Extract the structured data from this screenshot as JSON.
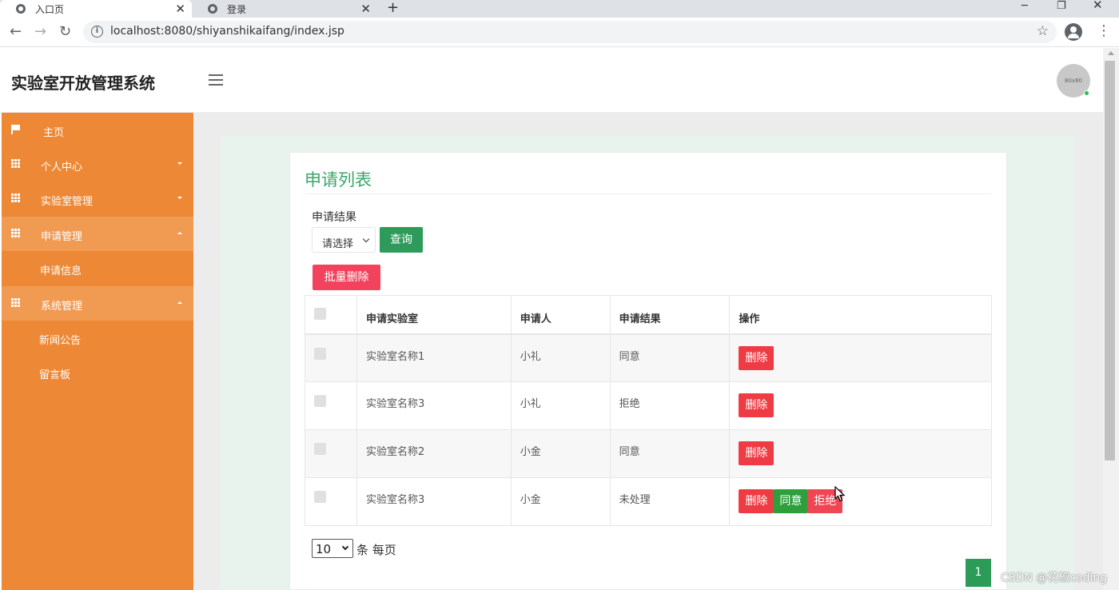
{
  "browser": {
    "tabs": [
      {
        "title": "入口页",
        "active": true
      },
      {
        "title": "登录",
        "active": false
      }
    ],
    "url": "localhost:8080/shiyanshikaifang/index.jsp"
  },
  "header": {
    "brand": "实验室开放管理系统",
    "avatar_text": "80x80"
  },
  "sidebar": {
    "items": [
      {
        "label": "主页",
        "icon": "flag-icon"
      },
      {
        "label": "个人中心",
        "icon": "grid-icon"
      },
      {
        "label": "实验室管理",
        "icon": "grid-icon"
      },
      {
        "label": "申请管理",
        "icon": "grid-icon"
      },
      {
        "label": "申请信息"
      },
      {
        "label": "系统管理",
        "icon": "grid-icon"
      },
      {
        "label": "新闻公告"
      },
      {
        "label": "留言板"
      }
    ]
  },
  "main": {
    "title": "申请列表",
    "filter": {
      "label": "申请结果",
      "select_value": "请选择",
      "query_button": "查询"
    },
    "batch_delete": "批量删除",
    "table": {
      "headers": [
        "申请实验室",
        "申请人",
        "申请结果",
        "操作"
      ],
      "rows": [
        {
          "lab": "实验室名称1",
          "applicant": "小礼",
          "result": "同意"
        },
        {
          "lab": "实验室名称3",
          "applicant": "小礼",
          "result": "拒绝"
        },
        {
          "lab": "实验室名称2",
          "applicant": "小金",
          "result": "同意"
        },
        {
          "lab": "实验室名称3",
          "applicant": "小金",
          "result": "未处理"
        }
      ],
      "actions": {
        "delete": "删除",
        "agree": "同意",
        "reject": "拒绝"
      }
    },
    "pager": {
      "page_size": "10",
      "page_size_label": "条 每页",
      "current_page": "1"
    }
  },
  "watermark": "CSDN @花椒coding",
  "colors": {
    "sidebar": "#ed8936",
    "accent_green": "#2e9b5a",
    "danger": "#ef3b44"
  }
}
